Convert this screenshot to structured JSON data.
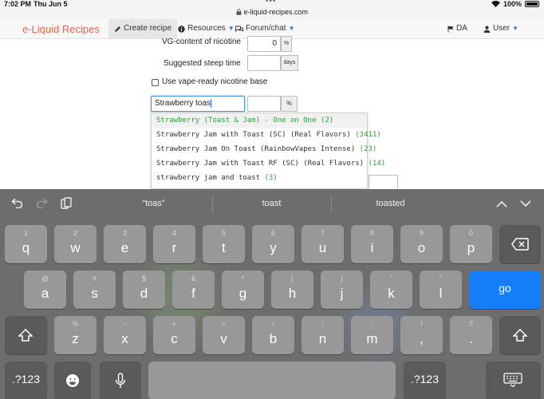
{
  "status": {
    "time": "7:02 PM",
    "date": "Thu Jun 5",
    "url": "e-liquid-recipes.com",
    "battery": "100%",
    "dots": "•••"
  },
  "nav": {
    "brand": "e-Liquid Recipes",
    "create": "Create recipe",
    "resources": "Resources",
    "forum": "Forum/chat",
    "lang": "DA",
    "user": "User",
    "create_icon": "pencil-icon",
    "resources_icon": "info-icon",
    "forum_icon": "chat-icon",
    "lang_icon": "flag-icon",
    "user_icon": "user-icon"
  },
  "form": {
    "vg_label": "VG-content of nicotine",
    "vg_value": "0",
    "vg_unit": "%",
    "steep_label": "Suggested steep time",
    "steep_value": "",
    "steep_unit": "days",
    "vape_ready_label": "Use vape-ready nicotine base",
    "flavor_value": "Strawberry toas",
    "flavor_percent": "",
    "flavor_unit": "%"
  },
  "suggestions": [
    {
      "name": "Strawberry (Toast & Jam) - One on One",
      "count": "(2)"
    },
    {
      "name": "Strawberry Jam with Toast (SC) (Real Flavors)",
      "count": "(3411)"
    },
    {
      "name": "Strawberry Jam On Toast (RainbowVapes Intense)",
      "count": "(23)"
    },
    {
      "name": "Strawberry Jam with Toast RF (SC) (Real Flavors)",
      "count": "(14)"
    },
    {
      "name": "strawberry jam and toast",
      "count": "(3)"
    }
  ],
  "keyboard": {
    "predictions": [
      "“toas”",
      "toast",
      "toasted"
    ],
    "row1": [
      {
        "sub": "1",
        "main": "q"
      },
      {
        "sub": "2",
        "main": "w"
      },
      {
        "sub": "3",
        "main": "e"
      },
      {
        "sub": "4",
        "main": "r"
      },
      {
        "sub": "5",
        "main": "t"
      },
      {
        "sub": "6",
        "main": "y"
      },
      {
        "sub": "7",
        "main": "u"
      },
      {
        "sub": "8",
        "main": "i"
      },
      {
        "sub": "9",
        "main": "o"
      },
      {
        "sub": "0",
        "main": "p"
      }
    ],
    "row2": [
      {
        "sub": "@",
        "main": "a"
      },
      {
        "sub": "#",
        "main": "s"
      },
      {
        "sub": "$",
        "main": "d"
      },
      {
        "sub": "&",
        "main": "f"
      },
      {
        "sub": "*",
        "main": "g"
      },
      {
        "sub": "(",
        "main": "h"
      },
      {
        "sub": ")",
        "main": "j"
      },
      {
        "sub": "’",
        "main": "k"
      },
      {
        "sub": "\"",
        "main": "l"
      }
    ],
    "row3": [
      {
        "sub": "%",
        "main": "z"
      },
      {
        "sub": "-",
        "main": "x"
      },
      {
        "sub": "+",
        "main": "c"
      },
      {
        "sub": "=",
        "main": "v"
      },
      {
        "sub": "/",
        "main": "b"
      },
      {
        "sub": ";",
        "main": "n"
      },
      {
        "sub": ":",
        "main": "m"
      },
      {
        "sub": "!",
        "main": ","
      },
      {
        "sub": "?",
        "main": "."
      }
    ],
    "go": "go",
    "numbers": ".?123"
  }
}
